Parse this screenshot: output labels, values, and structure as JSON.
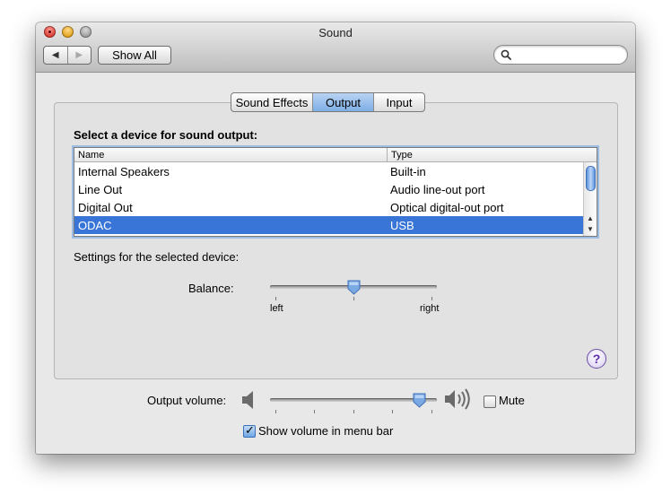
{
  "window": {
    "title": "Sound"
  },
  "toolbar": {
    "back_glyph": "◀",
    "forward_glyph": "▶",
    "show_all_label": "Show All",
    "search_placeholder": ""
  },
  "tabs": [
    {
      "label": "Sound Effects",
      "active": false
    },
    {
      "label": "Output",
      "active": true
    },
    {
      "label": "Input",
      "active": false
    }
  ],
  "output": {
    "select_label": "Select a device for sound output:",
    "columns": {
      "name": "Name",
      "type": "Type"
    },
    "devices": [
      {
        "name": "Internal Speakers",
        "type": "Built-in",
        "selected": false
      },
      {
        "name": "Line Out",
        "type": "Audio line-out port",
        "selected": false
      },
      {
        "name": "Digital Out",
        "type": "Optical digital-out port",
        "selected": false
      },
      {
        "name": "ODAC",
        "type": "USB",
        "selected": true
      }
    ],
    "settings_label": "Settings for the selected device:",
    "balance": {
      "label": "Balance:",
      "left_label": "left",
      "right_label": "right",
      "value": 0.5
    }
  },
  "help": {
    "glyph": "?"
  },
  "volume": {
    "label": "Output volume:",
    "value": 1.0,
    "mute_label": "Mute",
    "muted": false,
    "show_in_menu_label": "Show volume in menu bar",
    "show_in_menu": true
  },
  "colors": {
    "selection": "#3875d7",
    "accent": "#7eaee6"
  },
  "icons": {
    "search": "magnifier-icon",
    "speaker_low": "speaker-low-icon",
    "speaker_high": "speaker-high-icon"
  }
}
